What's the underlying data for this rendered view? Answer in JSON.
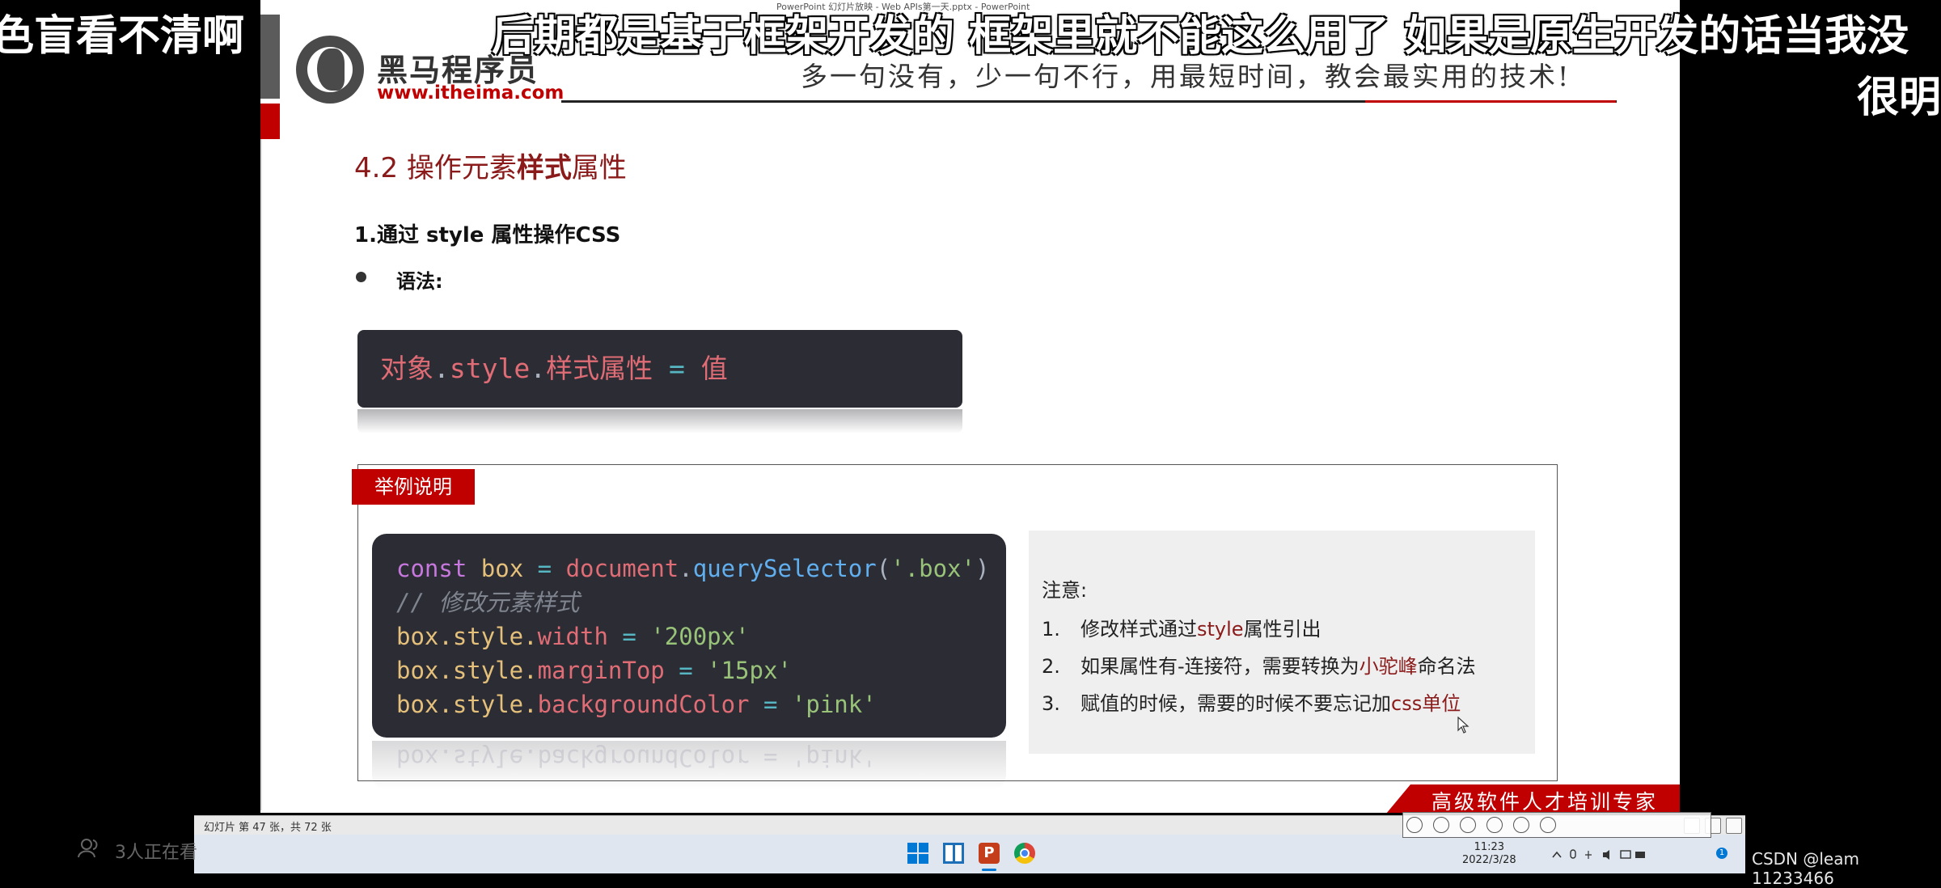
{
  "danmaku": {
    "left": "色盲看不清啊",
    "top": "后期都是基于框架开发的  框架里就不能这么用了  如果是原生开发的话当我没",
    "right": "很明"
  },
  "window_title": "PowerPoint 幻灯片放映 - Web APIs第一天.pptx - PowerPoint",
  "slide": {
    "logo_name": "黑马程序员",
    "logo_url": "www.itheima.com",
    "slogan": "多一句没有，少一句不行，用最短时间，教会最实用的技术!",
    "section_title_pre": "4.2 操作元素",
    "section_title_bold": "样式",
    "section_title_post": "属性",
    "subtitle": "1.通过 style 属性操作CSS",
    "bullet": "语法:",
    "syntax": {
      "obj": "对象",
      "dot1": ".",
      "style": "style",
      "dot2": ".",
      "prop": "样式属性",
      "eq": " = ",
      "val": "值"
    },
    "example_tag": "举例说明",
    "code": {
      "l1_const": "const",
      "l1_box": "box",
      "l1_eq": "=",
      "l1_doc": "document",
      "l1_dot": ".",
      "l1_fn": "querySelector",
      "l1_open": "(",
      "l1_arg": "'.box'",
      "l1_close": ")",
      "l2_comment": "// 修改元素样式",
      "l3_obj": "box.style.",
      "l3_prop": "width",
      "l3_eq": " = ",
      "l3_val": "'200px'",
      "l4_obj": "box.style.",
      "l4_prop": "marginTop",
      "l4_eq": " = ",
      "l4_val": "'15px'",
      "l5_obj": "box.style.",
      "l5_prop": "backgroundColor",
      "l5_eq": " = ",
      "l5_val": "'pink'"
    },
    "code_reflection": "box.style.backgroundColor = 'pink'",
    "notes": {
      "title": "注意:",
      "items": [
        {
          "num": "1.",
          "pre": "修改样式通过",
          "hl": "style",
          "post": "属性引出"
        },
        {
          "num": "2.",
          "pre": "如果属性有-连接符，需要转换为",
          "hl": "小驼峰",
          "post": "命名法"
        },
        {
          "num": "3.",
          "pre": "赋值的时候，需要的时候不要忘记加",
          "hl": "css单位",
          "post": ""
        }
      ]
    },
    "banner": "高级软件人才培训专家"
  },
  "status_bar": {
    "slide_info": "幻灯片 第 47 张，共 72 张"
  },
  "taskbar": {
    "clock_time": "11:23",
    "clock_date": "2022/3/28",
    "notification_count": "1"
  },
  "overlay": {
    "watchers": "3人正在看",
    "csdn": "CSDN @leam 11233466"
  },
  "colors": {
    "brand_red": "#c00000",
    "title_red": "#8b1a1a",
    "code_bg": "#2b2c34"
  }
}
